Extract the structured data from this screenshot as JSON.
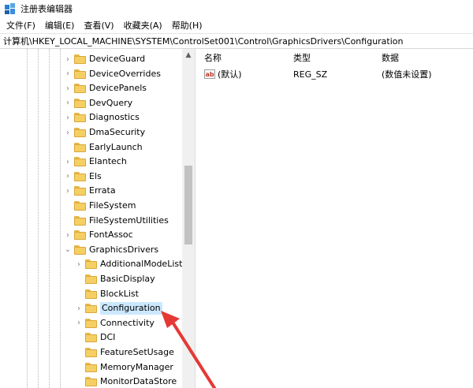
{
  "window": {
    "title": "注册表编辑器",
    "icon": "regedit-icon"
  },
  "menu": [
    {
      "label": "文件(F)"
    },
    {
      "label": "编辑(E)"
    },
    {
      "label": "查看(V)"
    },
    {
      "label": "收藏夹(A)"
    },
    {
      "label": "帮助(H)"
    }
  ],
  "address": {
    "path": "计算机\\HKEY_LOCAL_MACHINE\\SYSTEM\\ControlSet001\\Control\\GraphicsDrivers\\Configuration"
  },
  "tree": {
    "items": [
      {
        "label": "DeviceGuard",
        "expander": "collapsed",
        "level": 1
      },
      {
        "label": "DeviceOverrides",
        "expander": "collapsed",
        "level": 1
      },
      {
        "label": "DevicePanels",
        "expander": "collapsed",
        "level": 1
      },
      {
        "label": "DevQuery",
        "expander": "collapsed",
        "level": 1
      },
      {
        "label": "Diagnostics",
        "expander": "collapsed",
        "level": 1
      },
      {
        "label": "DmaSecurity",
        "expander": "collapsed",
        "level": 1
      },
      {
        "label": "EarlyLaunch",
        "expander": "none",
        "level": 1
      },
      {
        "label": "Elantech",
        "expander": "collapsed",
        "level": 1
      },
      {
        "label": "Els",
        "expander": "collapsed",
        "level": 1
      },
      {
        "label": "Errata",
        "expander": "collapsed",
        "level": 1
      },
      {
        "label": "FileSystem",
        "expander": "none",
        "level": 1
      },
      {
        "label": "FileSystemUtilities",
        "expander": "none",
        "level": 1
      },
      {
        "label": "FontAssoc",
        "expander": "collapsed",
        "level": 1
      },
      {
        "label": "GraphicsDrivers",
        "expander": "expanded",
        "level": 1
      },
      {
        "label": "AdditionalModeLists",
        "expander": "collapsed",
        "level": 2
      },
      {
        "label": "BasicDisplay",
        "expander": "none",
        "level": 2
      },
      {
        "label": "BlockList",
        "expander": "none",
        "level": 2
      },
      {
        "label": "Configuration",
        "expander": "collapsed",
        "level": 2,
        "selected": true
      },
      {
        "label": "Connectivity",
        "expander": "collapsed",
        "level": 2
      },
      {
        "label": "DCI",
        "expander": "none",
        "level": 2
      },
      {
        "label": "FeatureSetUsage",
        "expander": "none",
        "level": 2
      },
      {
        "label": "MemoryManager",
        "expander": "none",
        "level": 2
      },
      {
        "label": "MonitorDataStore",
        "expander": "none",
        "level": 2
      }
    ]
  },
  "values": {
    "columns": [
      "名称",
      "类型",
      "数据"
    ],
    "rows": [
      {
        "icon": "string-value-icon",
        "icon_text": "ab",
        "name": "(默认)",
        "type": "REG_SZ",
        "data": "(数值未设置)"
      }
    ]
  },
  "annotation": {
    "arrow_color": "#e53935"
  }
}
